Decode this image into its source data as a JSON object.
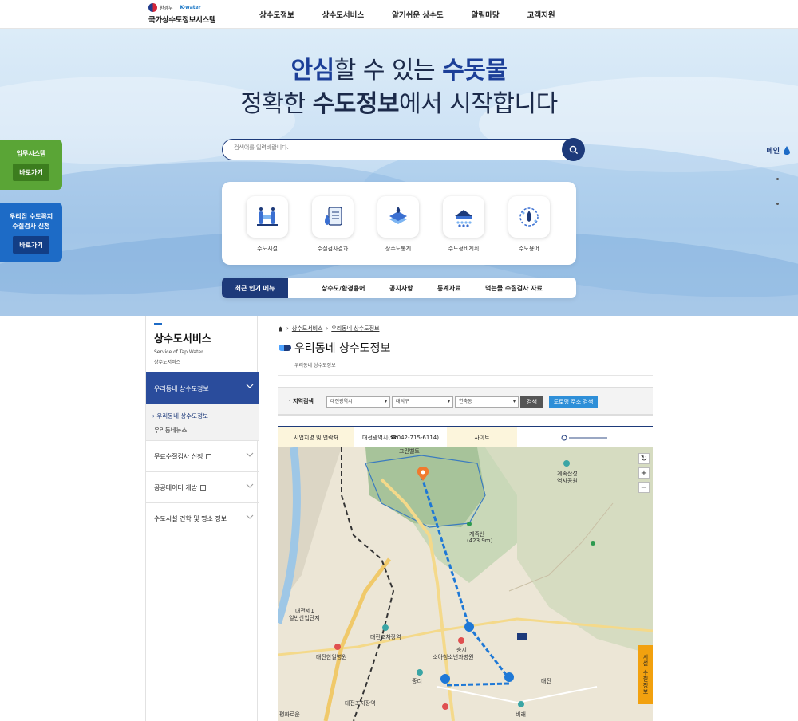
{
  "header": {
    "ministry": "환경부",
    "kwater": "K-water",
    "site_title": "국가상수도정보시스템",
    "nav": [
      "상수도정보",
      "상수도서비스",
      "알기쉬운 상수도",
      "알림마당",
      "고객지원"
    ]
  },
  "hero": {
    "line1_em1": "안심",
    "line1_mid": "할 수 있는 ",
    "line1_em2": "수돗물",
    "line2_pre": "정확한 ",
    "line2_em": "수도정보",
    "line2_post": "에서 시작합니다",
    "search_placeholder": "검색어를 입력바랍니다."
  },
  "quick_menu": [
    {
      "label": "수도시설",
      "icon": "pipe-facility-icon"
    },
    {
      "label": "수질검사결과",
      "icon": "water-test-result-icon"
    },
    {
      "label": "상수도통계",
      "icon": "water-statistics-icon"
    },
    {
      "label": "수도정비계획",
      "icon": "water-maintenance-plan-icon"
    },
    {
      "label": "수도용어",
      "icon": "water-glossary-icon"
    }
  ],
  "popular": {
    "tag": "최근 인기 메뉴",
    "links": [
      "상수도/환경용어",
      "공지사항",
      "통계자료",
      "먹는물 수질검사 자료"
    ]
  },
  "side_cards": [
    {
      "title": "업무시스템",
      "button": "바로가기"
    },
    {
      "title_l1": "우리집 수도꼭지",
      "title_l2": "수질검사 신청",
      "button": "바로가기"
    }
  ],
  "pager": {
    "label": "메인"
  },
  "lnb": {
    "title": "상수도서비스",
    "en": "Service of Tap Water",
    "sub": "상수도서비스",
    "active": "우리동네 상수도정보",
    "sub_items": [
      "› 우리동네 상수도정보",
      "우리동네뉴스"
    ],
    "items": [
      "무료수질검사 신청",
      "공공데이터 개방",
      "수도시설 견학 및 명소 정보"
    ]
  },
  "content": {
    "breadcrumb": [
      "상수도서비스",
      "우리동네 상수도정보"
    ],
    "title": "우리동네 상수도정보",
    "subtitle": "우리동네 상수도정보",
    "filter": {
      "label": "· 지역검색",
      "city": "대전광역시",
      "district": "대덕구",
      "dong": "연축동",
      "search": "검색",
      "road": "도로명 주소 검색"
    },
    "tabs": [
      "시업지명 및 연락처",
      "대전광역시(☎042-715-6114)",
      "사이트"
    ],
    "map": {
      "tag": "시설·수질정보",
      "labels": [
        "계족산",
        "(423.9m)",
        "계족산성",
        "역사공원",
        "대전제1",
        "일반산업단지",
        "대전조차장역",
        "대전한일병원",
        "충지",
        "소아청소년과병원",
        "대전",
        "중리",
        "평화로운",
        "아파트",
        "대전조차장역",
        "그린벨트",
        "비래",
        "금강빌트"
      ]
    }
  }
}
